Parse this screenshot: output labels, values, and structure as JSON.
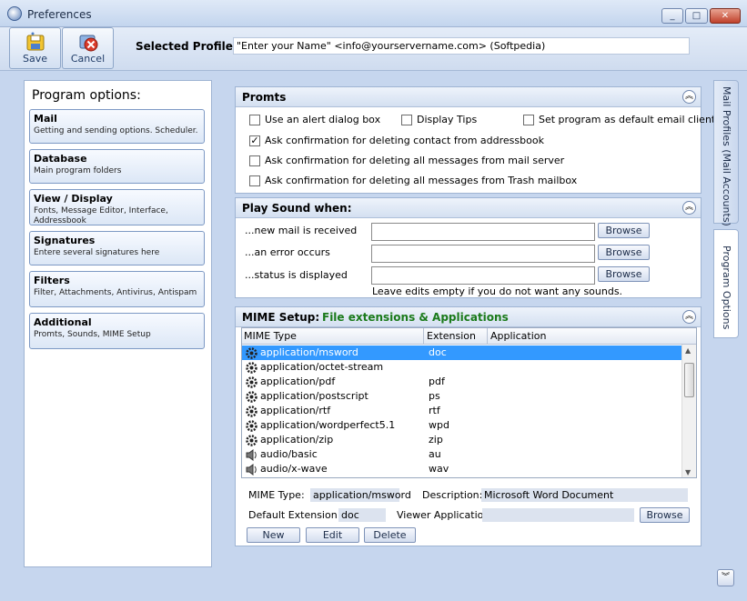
{
  "window": {
    "title": "Preferences",
    "min": "_",
    "max": "□",
    "close": "✕"
  },
  "toolbar": {
    "save_label": "Save",
    "cancel_label": "Cancel",
    "profile_label": "Selected Profile:",
    "profile_value": "\"Enter your Name\" <info@yourservername.com> (Softpedia)"
  },
  "left": {
    "header": "Program options:",
    "items": [
      {
        "title": "Mail",
        "desc": "Getting and sending options. Scheduler."
      },
      {
        "title": "Database",
        "desc": "Main program folders"
      },
      {
        "title": "View / Display",
        "desc": "Fonts, Message Editor, Interface, Addressbook"
      },
      {
        "title": "Signatures",
        "desc": "Entere several signatures here"
      },
      {
        "title": "Filters",
        "desc": "Filter, Attachments, Antivirus, Antispam"
      },
      {
        "title": "Additional",
        "desc": "Promts, Sounds, MIME Setup"
      }
    ]
  },
  "promts": {
    "title": "Promts",
    "options": [
      {
        "label": "Use an alert dialog box",
        "checked": false
      },
      {
        "label": "Display Tips",
        "checked": false
      },
      {
        "label": "Set program as default email client",
        "checked": false
      },
      {
        "label": "Ask confirmation for deleting contact from addressbook",
        "checked": true
      },
      {
        "label": "Ask confirmation for deleting all messages from mail server",
        "checked": false
      },
      {
        "label": "Ask confirmation for deleting all messages from Trash mailbox",
        "checked": false
      }
    ]
  },
  "sound": {
    "title": "Play Sound when:",
    "rows": [
      {
        "label": "...new mail is received",
        "button": "Browse"
      },
      {
        "label": "...an error occurs",
        "button": "Browse"
      },
      {
        "label": "...status is displayed",
        "button": "Browse"
      }
    ],
    "hint": "Leave edits empty if you do not want any sounds."
  },
  "mime": {
    "title": "MIME Setup:",
    "subtitle": "File extensions & Applications",
    "columns": [
      "MIME Type",
      "Extension",
      "Application"
    ],
    "rows": [
      {
        "type": "application/msword",
        "ext": "doc",
        "icon": "gear-icon"
      },
      {
        "type": "application/octet-stream",
        "ext": "",
        "icon": "gear-icon"
      },
      {
        "type": "application/pdf",
        "ext": "pdf",
        "icon": "gear-icon"
      },
      {
        "type": "application/postscript",
        "ext": "ps",
        "icon": "gear-icon"
      },
      {
        "type": "application/rtf",
        "ext": "rtf",
        "icon": "gear-icon"
      },
      {
        "type": "application/wordperfect5.1",
        "ext": "wpd",
        "icon": "gear-icon"
      },
      {
        "type": "application/zip",
        "ext": "zip",
        "icon": "gear-icon"
      },
      {
        "type": "audio/basic",
        "ext": "au",
        "icon": "speaker-icon"
      },
      {
        "type": "audio/x-wave",
        "ext": "wav",
        "icon": "speaker-icon"
      }
    ],
    "selected_index": 0,
    "mime_type_label": "MIME Type:",
    "mime_type_value": "application/msword",
    "description_label": "Description:",
    "description_value": "Microsoft Word Document",
    "default_ext_label": "Default Extension:",
    "default_ext_value": "doc",
    "viewer_label": "Viewer Application:",
    "viewer_value": "",
    "browse": "Browse",
    "new": "New",
    "edit": "Edit",
    "delete": "Delete"
  },
  "sidetabs": [
    "Mail Profiles (Mail Accounts)",
    "Program Options"
  ],
  "colors": {
    "selected_row": "#3399ff",
    "subtitle_green": "#1a7a1a"
  }
}
